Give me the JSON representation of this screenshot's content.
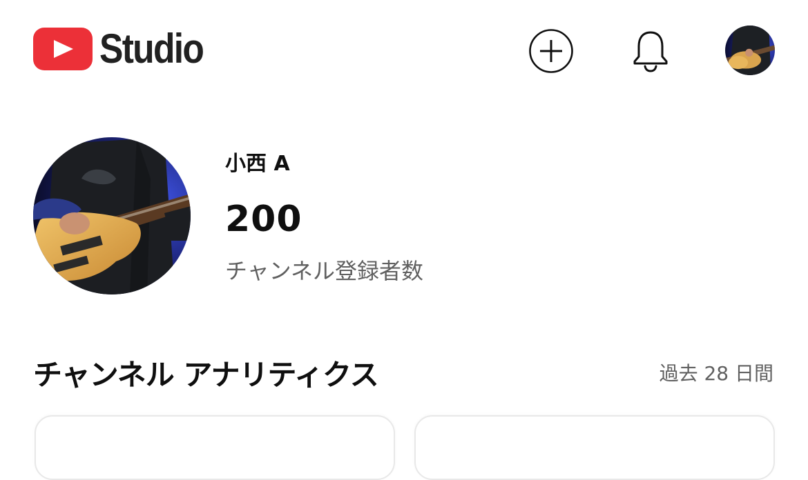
{
  "header": {
    "logo_text": "Studio",
    "logo_icon": "youtube-play-icon",
    "create_icon": "plus-circle-icon",
    "notifications_icon": "bell-icon",
    "brand_color": "#ec3038"
  },
  "profile": {
    "channel_name": "小西 A",
    "subscriber_count": "200",
    "subscriber_label": "チャンネル登録者数"
  },
  "analytics": {
    "title": "チャンネル アナリティクス",
    "period": "過去 28 日間"
  }
}
